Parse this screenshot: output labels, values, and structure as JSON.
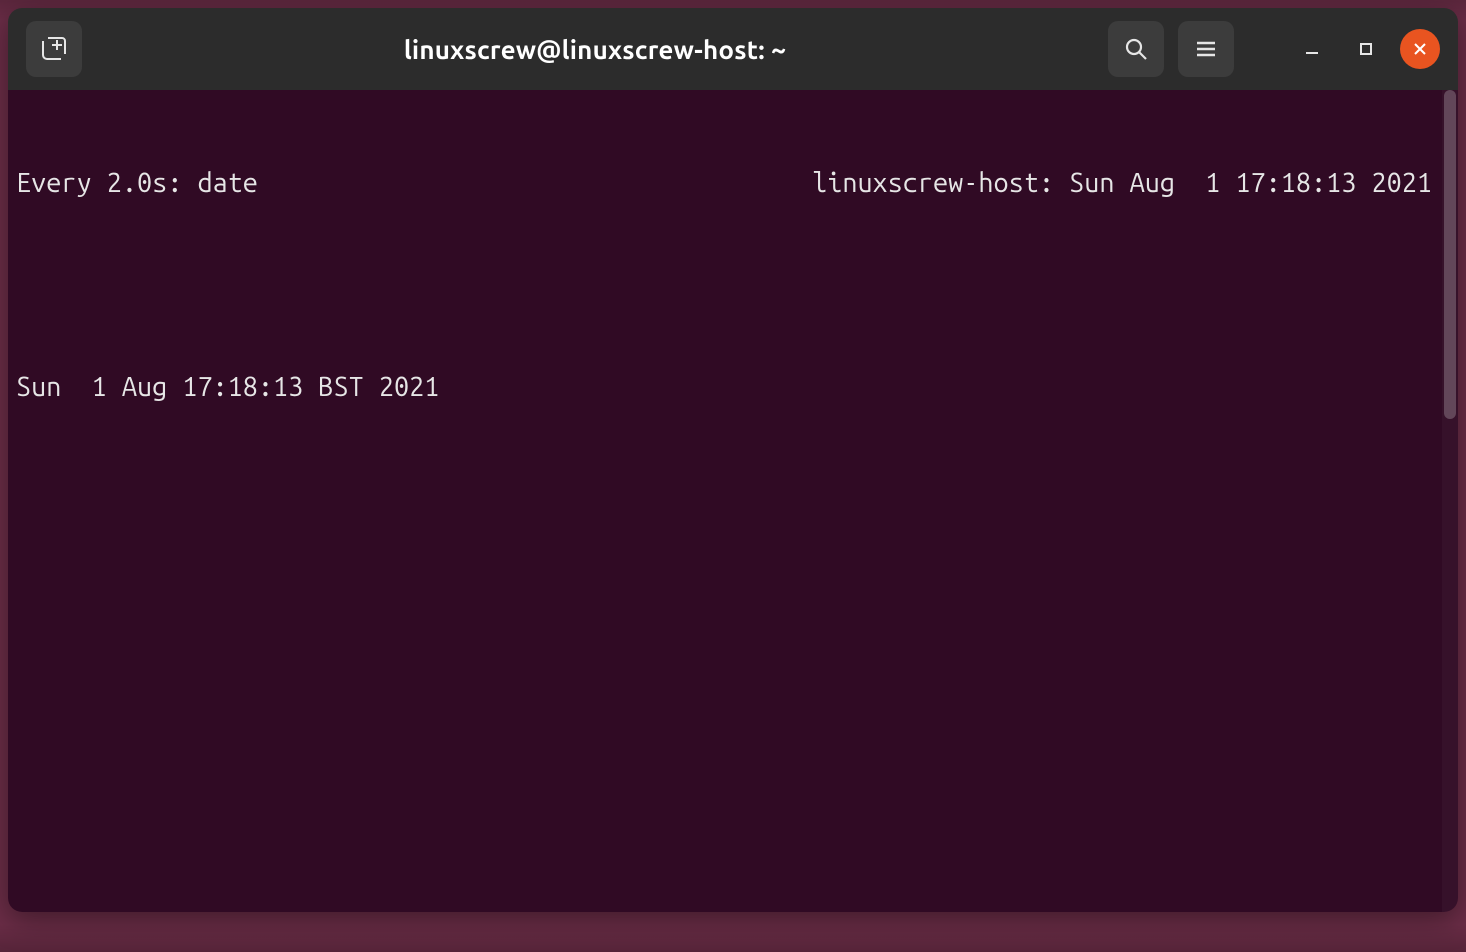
{
  "window": {
    "title": "linuxscrew@linuxscrew-host: ~"
  },
  "terminal": {
    "watch_left": "Every 2.0s: date",
    "watch_right": "linuxscrew-host: Sun Aug  1 17:18:13 2021",
    "output_line": "Sun  1 Aug 17:18:13 BST 2021"
  },
  "icons": {
    "new_tab": "new-tab-icon",
    "search": "search-icon",
    "menu": "hamburger-menu-icon",
    "minimize": "minimize-icon",
    "maximize": "maximize-icon",
    "close": "close-icon"
  },
  "colors": {
    "titlebar": "#2c2c2c",
    "terminal_bg": "#300a24",
    "close_btn": "#e95420",
    "text": "#e6e6e6"
  }
}
